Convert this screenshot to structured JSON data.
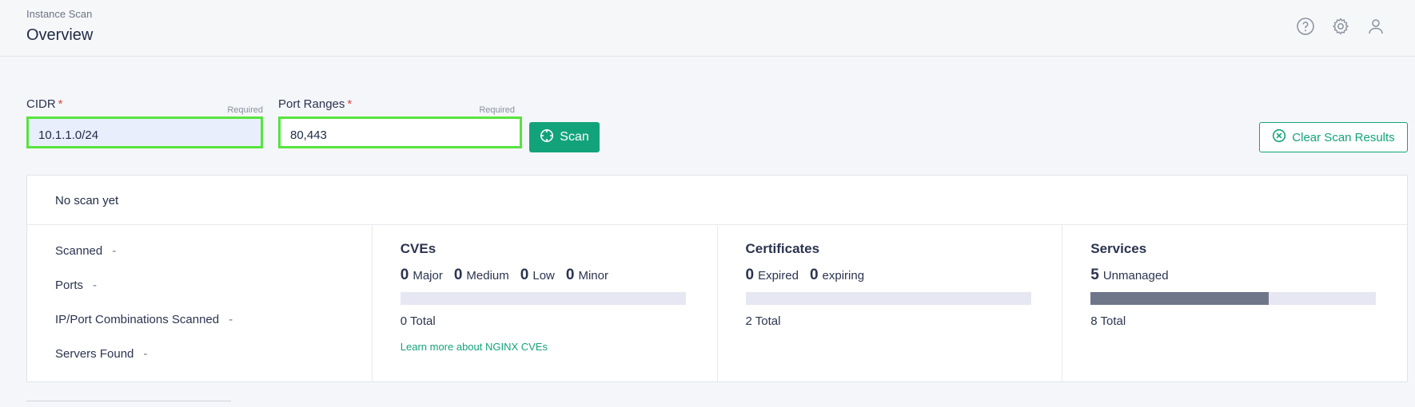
{
  "header": {
    "breadcrumb": "Instance Scan",
    "title": "Overview",
    "icons": [
      "help-icon",
      "gear-icon",
      "user-icon"
    ]
  },
  "form": {
    "cidr": {
      "label": "CIDR",
      "required_mark": "*",
      "required_hint": "Required",
      "value": "10.1.1.0/24"
    },
    "ports": {
      "label": "Port Ranges",
      "required_mark": "*",
      "required_hint": "Required",
      "value": "80,443"
    },
    "scan_label": "Scan",
    "clear_label": "Clear Scan Results"
  },
  "summary": {
    "status": "No scan yet",
    "stats": [
      {
        "label": "Scanned",
        "value": "-"
      },
      {
        "label": "Ports",
        "value": "-"
      },
      {
        "label": "IP/Port Combinations Scanned",
        "value": "-"
      },
      {
        "label": "Servers Found",
        "value": "-"
      }
    ],
    "cves": {
      "title": "CVEs",
      "counts": [
        {
          "n": "0",
          "label": "Major"
        },
        {
          "n": "0",
          "label": "Medium"
        },
        {
          "n": "0",
          "label": "Low"
        },
        {
          "n": "0",
          "label": "Minor"
        }
      ],
      "total": "0 Total",
      "progress": 0,
      "link": "Learn more about NGINX CVEs"
    },
    "certificates": {
      "title": "Certificates",
      "counts": [
        {
          "n": "0",
          "label": "Expired"
        },
        {
          "n": "0",
          "label": "expiring"
        }
      ],
      "total": "2 Total",
      "progress": 0
    },
    "services": {
      "title": "Services",
      "counts": [
        {
          "n": "5",
          "label": "Unmanaged"
        }
      ],
      "total": "8 Total",
      "progress": 0.625
    }
  },
  "colors": {
    "accent": "#13a37a",
    "highlight": "#57e43e",
    "bar_fill": "#6f768a",
    "bar_bg": "#e6e7f2"
  }
}
